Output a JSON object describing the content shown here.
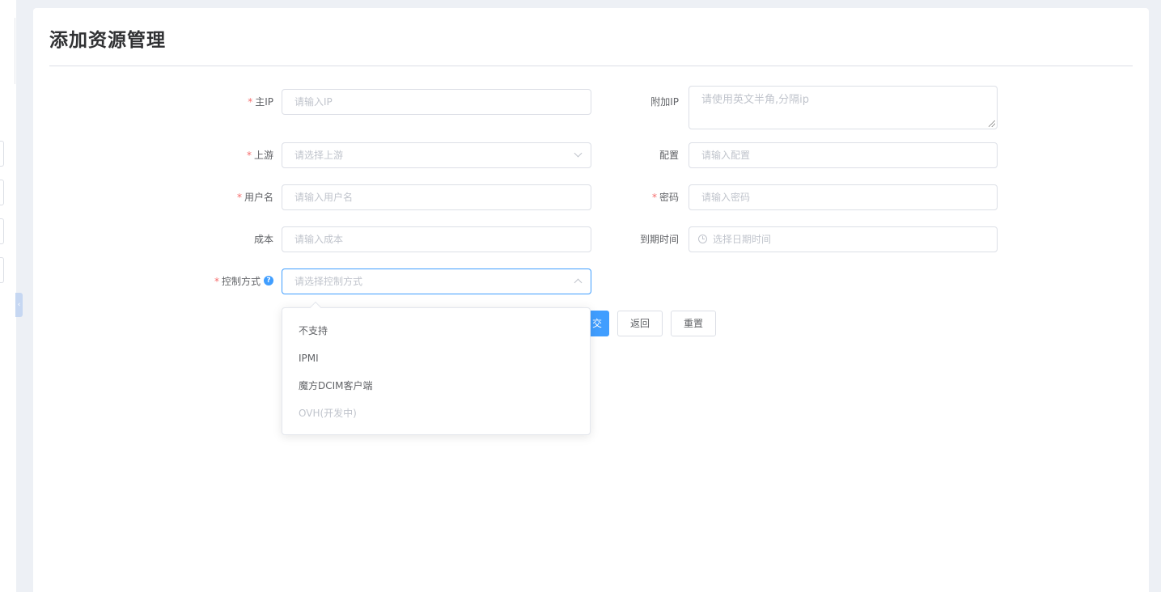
{
  "page": {
    "title": "添加资源管理"
  },
  "form": {
    "main_ip": {
      "label": "主IP",
      "required": true,
      "placeholder": "请输入IP"
    },
    "extra_ip": {
      "label": "附加IP",
      "required": false,
      "placeholder": "请使用英文半角,分隔ip"
    },
    "upstream": {
      "label": "上游",
      "required": true,
      "placeholder": "请选择上游"
    },
    "config": {
      "label": "配置",
      "required": false,
      "placeholder": "请输入配置"
    },
    "username": {
      "label": "用户名",
      "required": true,
      "placeholder": "请输入用户名"
    },
    "password": {
      "label": "密码",
      "required": true,
      "placeholder": "请输入密码"
    },
    "cost": {
      "label": "成本",
      "required": false,
      "placeholder": "请输入成本"
    },
    "expire_time": {
      "label": "到期时间",
      "required": false,
      "placeholder": "选择日期时间"
    },
    "control_method": {
      "label": "控制方式",
      "required": true,
      "placeholder": "请选择控制方式",
      "help_icon": "?",
      "options": [
        {
          "label": "不支持",
          "disabled": false
        },
        {
          "label": "IPMI",
          "disabled": false
        },
        {
          "label": "魔方DCIM客户端",
          "disabled": false
        },
        {
          "label": "OVH(开发中)",
          "disabled": true
        }
      ]
    }
  },
  "actions": {
    "submit_label": "交",
    "back_label": "返回",
    "reset_label": "重置"
  },
  "sidebar": {
    "collapse_glyph": "‹"
  },
  "colors": {
    "primary": "#409eff",
    "required": "#f56c6c",
    "border": "#dcdfe6",
    "placeholder": "#c0c4cc"
  }
}
